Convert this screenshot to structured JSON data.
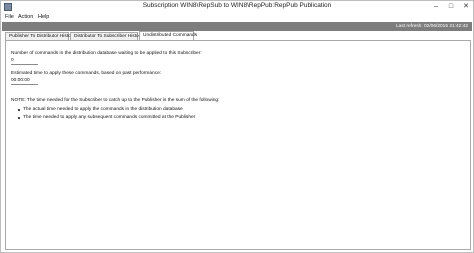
{
  "window": {
    "title": "Subscription WIN8\\RepSub to WIN8\\RepPub:RepPub Publication",
    "icon": "app-icon",
    "controls": {
      "minimize": "–",
      "maximize": "□",
      "close": "✕"
    }
  },
  "menu": {
    "items": [
      "File",
      "Action",
      "Help"
    ]
  },
  "status": {
    "last_refresh": "Last refresh: 02/06/2015 21:42:42"
  },
  "tabs": [
    {
      "label": "Publisher To Distributor History"
    },
    {
      "label": "Distributor To Subscriber History"
    },
    {
      "label": "Undistributed Commands"
    }
  ],
  "undistributed": {
    "commands_label": "Number of commands in the distribution database waiting to be applied to this Subscriber:",
    "commands_value": "0",
    "time_label": "Estimated time to apply these commands, based on past performance:",
    "time_value": "00:00:00",
    "note": "NOTE: The time needed for the Subscriber to catch up to the Publisher is the sum of the following:",
    "bullets": [
      "The actual time needed to apply the commands in the distribution database",
      "The time needed to apply any subsequent commands committed at the Publisher"
    ]
  }
}
